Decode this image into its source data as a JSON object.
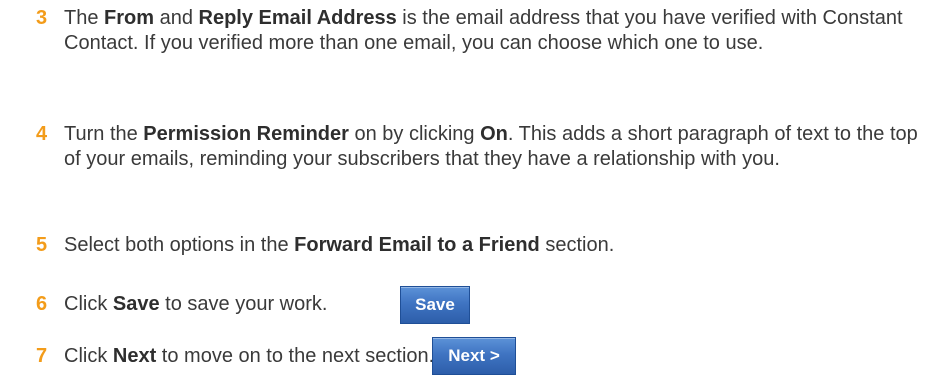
{
  "steps": [
    {
      "number": "3",
      "parts": [
        {
          "text": "The ",
          "bold": false
        },
        {
          "text": "From",
          "bold": true
        },
        {
          "text": " and ",
          "bold": false
        },
        {
          "text": "Reply Email Address",
          "bold": true
        },
        {
          "text": " is the email address that you have verified with Constant Contact. If you verified more than one email, you can choose which one to use.",
          "bold": false
        }
      ]
    },
    {
      "number": "4",
      "parts": [
        {
          "text": "Turn the ",
          "bold": false
        },
        {
          "text": "Permission Reminder",
          "bold": true
        },
        {
          "text": " on by clicking ",
          "bold": false
        },
        {
          "text": "On",
          "bold": true
        },
        {
          "text": ". This adds a short paragraph of text to the top of your emails, reminding your subscribers that they have a relationship with you.",
          "bold": false
        }
      ]
    },
    {
      "number": "5",
      "parts": [
        {
          "text": "Select both options in the ",
          "bold": false
        },
        {
          "text": "Forward Email to a Friend",
          "bold": true
        },
        {
          "text": " section.",
          "bold": false
        }
      ]
    },
    {
      "number": "6",
      "parts": [
        {
          "text": "Click ",
          "bold": false
        },
        {
          "text": "Save",
          "bold": true
        },
        {
          "text": " to save your work.",
          "bold": false
        }
      ]
    },
    {
      "number": "7",
      "parts": [
        {
          "text": "Click ",
          "bold": false
        },
        {
          "text": "Next",
          "bold": true
        },
        {
          "text": " to move on to the next section.",
          "bold": false
        }
      ]
    }
  ],
  "buttons": {
    "save_label": "Save",
    "next_label": "Next >"
  },
  "colors": {
    "step_number": "#f39c1a",
    "body_text": "#3a3a3a",
    "button_blue": "#3f74c2"
  }
}
